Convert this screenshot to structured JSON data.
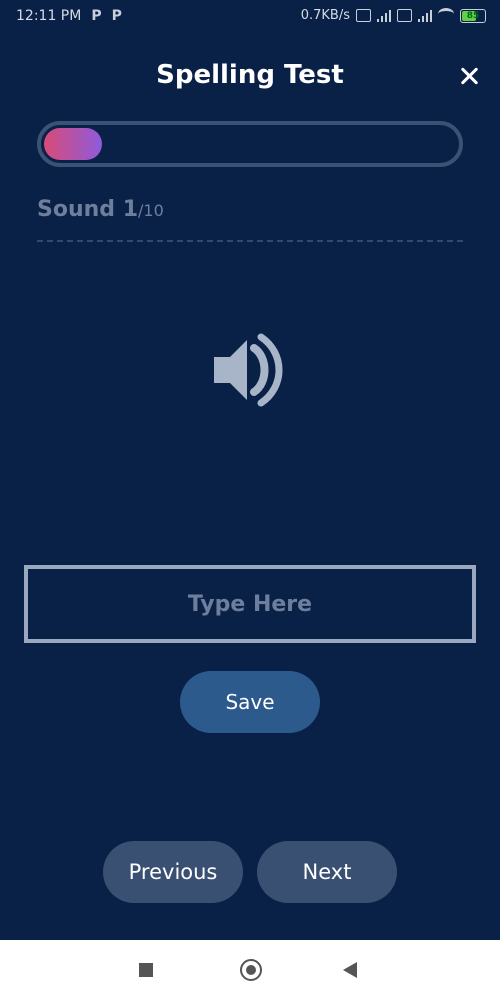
{
  "status_bar": {
    "time": "12:11 PM",
    "left_icons": [
      "P",
      "P"
    ],
    "network_speed": "0.7KB/s",
    "battery_level": "85"
  },
  "header": {
    "title": "Spelling Test"
  },
  "progress": {
    "current": 1,
    "total": 10
  },
  "sound": {
    "label": "Sound",
    "current": "1",
    "total": "/10"
  },
  "input": {
    "placeholder": "Type Here",
    "value": ""
  },
  "buttons": {
    "save": "Save",
    "previous": "Previous",
    "next": "Next"
  },
  "colors": {
    "background": "#0a2147",
    "progress_start": "#d94b78",
    "progress_end": "#8d5bdc",
    "save_button": "#2d5a8c",
    "nav_button": "#3a5073"
  },
  "icons": {
    "close": "close-icon",
    "speaker": "speaker-icon"
  }
}
